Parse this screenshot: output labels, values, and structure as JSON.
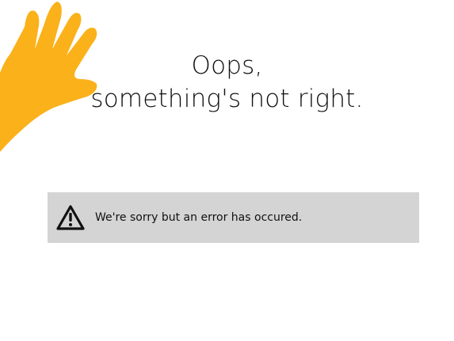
{
  "page": {
    "heading_line1": "Oops,",
    "heading_line2": "something's not right."
  },
  "alert": {
    "icon": "warning-triangle-icon",
    "message": "We're sorry but an error has occured."
  },
  "decoration": {
    "icon": "hand-illustration",
    "color": "#fbb11a"
  }
}
